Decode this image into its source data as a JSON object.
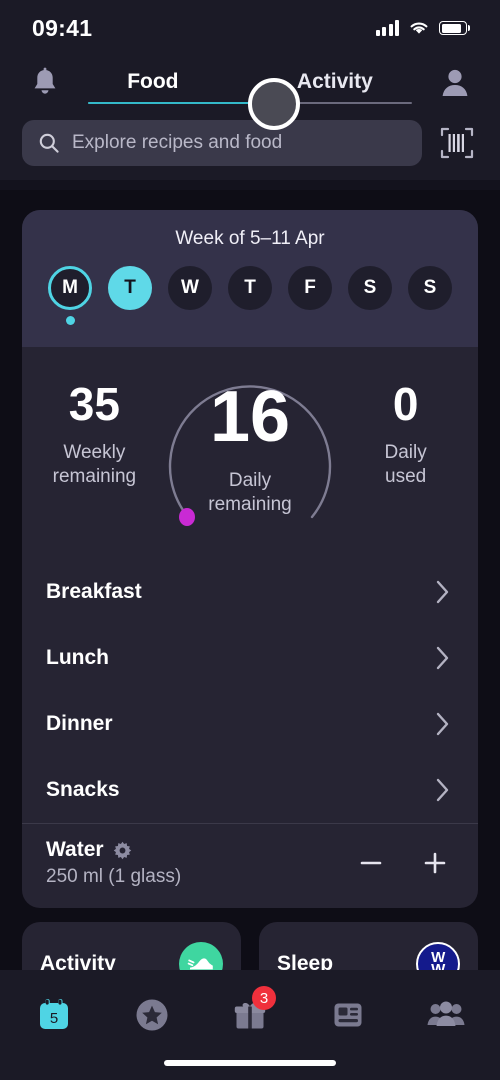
{
  "status_bar": {
    "time": "09:41",
    "cellular_icon": "signal-bars-icon",
    "wifi_icon": "wifi-icon",
    "battery_icon": "battery-icon"
  },
  "header": {
    "notification_icon": "bell-icon",
    "profile_icon": "avatar-icon",
    "tabs": [
      {
        "label": "Food",
        "active": true
      },
      {
        "label": "Activity",
        "active": false
      }
    ],
    "slider_handle_icon": "slider-knob",
    "active_color": "#34b9c9"
  },
  "search": {
    "placeholder": "Explore recipes and food",
    "value": "",
    "search_icon": "search-icon",
    "barcode_icon": "barcode-scanner-icon"
  },
  "week_card": {
    "title": "Week of 5–11 Apr",
    "days": [
      {
        "label": "M",
        "state": "selected-outline",
        "has_dot": true
      },
      {
        "label": "T",
        "state": "filled",
        "has_dot": false
      },
      {
        "label": "W",
        "state": "default",
        "has_dot": false
      },
      {
        "label": "T",
        "state": "default",
        "has_dot": false
      },
      {
        "label": "F",
        "state": "default",
        "has_dot": false
      },
      {
        "label": "S",
        "state": "default",
        "has_dot": false
      },
      {
        "label": "S",
        "state": "default",
        "has_dot": false
      }
    ],
    "accent_color": "#4fd4e4"
  },
  "stats": {
    "weekly": {
      "value": "35",
      "label_line1": "Weekly",
      "label_line2": "remaining"
    },
    "daily_remaining": {
      "value": "16",
      "label_line1": "Daily",
      "label_line2": "remaining"
    },
    "daily_used": {
      "value": "0",
      "label_line1": "Daily",
      "label_line2": "used"
    },
    "ring_track_color": "#8e8ca3",
    "ring_marker_color": "#c92ad4"
  },
  "meals": [
    {
      "name": "Breakfast",
      "chevron_icon": "chevron-right-icon"
    },
    {
      "name": "Lunch",
      "chevron_icon": "chevron-right-icon"
    },
    {
      "name": "Dinner",
      "chevron_icon": "chevron-right-icon"
    },
    {
      "name": "Snacks",
      "chevron_icon": "chevron-right-icon"
    }
  ],
  "water": {
    "title": "Water",
    "settings_icon": "gear-icon",
    "amount": "250 ml (1 glass)",
    "decrement_label": "−",
    "increment_label": "+"
  },
  "bottom_cards": [
    {
      "title": "Activity",
      "icon": "sneaker-icon",
      "icon_bg": "#3fd6a0"
    },
    {
      "title": "Sleep",
      "icon": "ww-logo-icon",
      "icon_bg": "#141a8c"
    }
  ],
  "bottom_nav": [
    {
      "name": "calendar",
      "icon": "calendar-icon",
      "day_number": "5",
      "active": true,
      "badge": null
    },
    {
      "name": "favorites",
      "icon": "star-circle-icon",
      "active": false,
      "badge": null
    },
    {
      "name": "rewards",
      "icon": "gift-icon",
      "active": false,
      "badge": "3"
    },
    {
      "name": "articles",
      "icon": "news-icon",
      "active": false,
      "badge": null
    },
    {
      "name": "community",
      "icon": "people-icon",
      "active": false,
      "badge": null
    }
  ],
  "home_indicator": "home-bar"
}
